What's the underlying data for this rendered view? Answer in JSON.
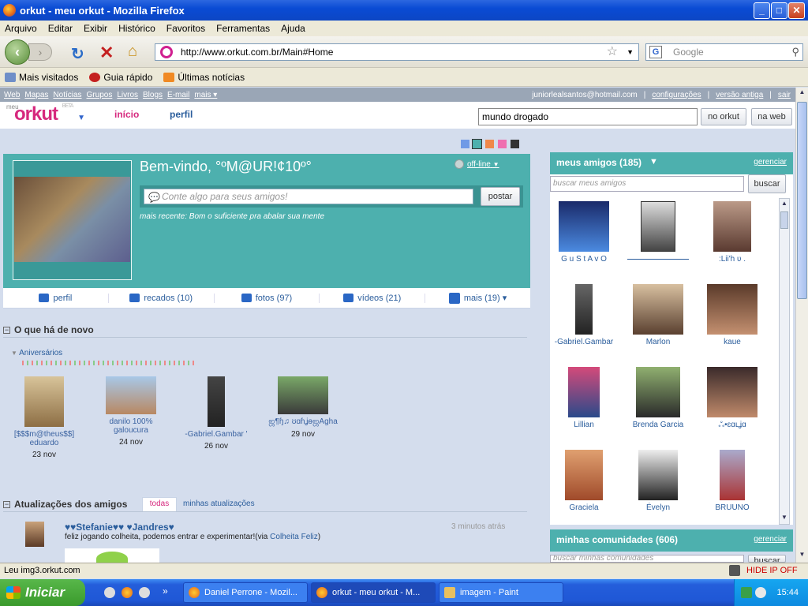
{
  "window": {
    "title": "orkut - meu orkut - Mozilla Firefox",
    "min": "_",
    "max": "□",
    "close": "✕"
  },
  "menu": [
    "Arquivo",
    "Editar",
    "Exibir",
    "Histórico",
    "Favoritos",
    "Ferramentas",
    "Ajuda"
  ],
  "nav": {
    "back": "‹",
    "forward": "›",
    "url": "http://www.orkut.com.br/Main#Home",
    "search_placeholder": "Google",
    "star": "☆"
  },
  "bookmarks": [
    "Mais visitados",
    "Guia rápido",
    "Últimas notícias"
  ],
  "gbar": {
    "links": [
      "Web",
      "Mapas",
      "Notícias",
      "Grupos",
      "Livros",
      "Blogs",
      "E-mail",
      "mais ▾"
    ],
    "email": "juniorlealsantos@hotmail.com",
    "settings": "configurações",
    "old_version": "versão antiga",
    "logout": "sair"
  },
  "header": {
    "logo_prefix": "meu",
    "logo": "orkut",
    "logo_beta": "BETA",
    "nav_home": "início",
    "nav_profile": "perfil",
    "search_value": "mundo drogado",
    "btn_orkut": "no orkut",
    "btn_web": "na web"
  },
  "welcome": {
    "title": "Bem-vindo, °ºM@UR!¢10º°",
    "status": "off-line",
    "post_placeholder": "Conte algo para seus amigos!",
    "post_button": "postar",
    "recent": "mais recente: Bom o suficiente pra abalar sua mente"
  },
  "tabs": [
    {
      "label": "perfil",
      "icon": "profile-icon"
    },
    {
      "label": "recados (10)",
      "icon": "pencil-icon"
    },
    {
      "label": "fotos (97)",
      "icon": "camera-icon"
    },
    {
      "label": "vídeos (21)",
      "icon": "video-icon"
    },
    {
      "label": "mais (19) ▾",
      "icon": "plus-icon"
    }
  ],
  "news": {
    "title": "O que há de novo",
    "birthdays_label": "Aniversários",
    "birthdays": [
      {
        "name": "[$$$m@theus$$] eduardo",
        "date": "23 nov"
      },
      {
        "name": "danilo 100% galoucura",
        "date": "24 nov"
      },
      {
        "name": "-Gabriel.Gambar '",
        "date": "26 nov"
      },
      {
        "name": "ஜ¶ɧ♫ ʊɑɦʝɵஜAgha",
        "date": "29 nov"
      }
    ]
  },
  "updates": {
    "title": "Atualizações dos amigos",
    "tab_all": "todas",
    "tab_mine": "minhas atualizações",
    "item_author": "♥♥Stefanie♥♥ ♥Jandres♥",
    "item_time": "3 minutos atrás",
    "item_text": "feliz jogando colheita, podemos entrar e experimentar!(via ",
    "item_link": "Colheita Feliz",
    "item_text_end": ")"
  },
  "friends": {
    "title": "meus amigos (185)",
    "manage": "gerenciar",
    "search_placeholder": "buscar meus amigos",
    "search_button": "buscar",
    "list": [
      "G u S t A v O",
      "",
      ":Lii'h ʋ .",
      "-Gabriel.Gambar",
      "Marlon",
      "kaue",
      "Lillian",
      "Brenda Garcia",
      "ஃ•ɛɑւʝɑ",
      "Graciela",
      "Évelyn",
      "BRUUNO"
    ]
  },
  "communities": {
    "title": "minhas comunidades (606)",
    "manage": "gerenciar",
    "search_placeholder": "buscar minhas comunidades",
    "search_button": "buscar"
  },
  "statusbar": {
    "text": "Leu img3.orkut.com",
    "addon": "HIDE IP OFF"
  },
  "taskbar": {
    "start": "Iniciar",
    "tasks": [
      "Daniel Perrone - Mozil...",
      "orkut - meu orkut - M...",
      "imagem - Paint"
    ],
    "clock": "15:44"
  },
  "colors": {
    "orkut_pink": "#d6297e",
    "teal": "#4db0ae",
    "link_blue": "#2a5d9c"
  }
}
